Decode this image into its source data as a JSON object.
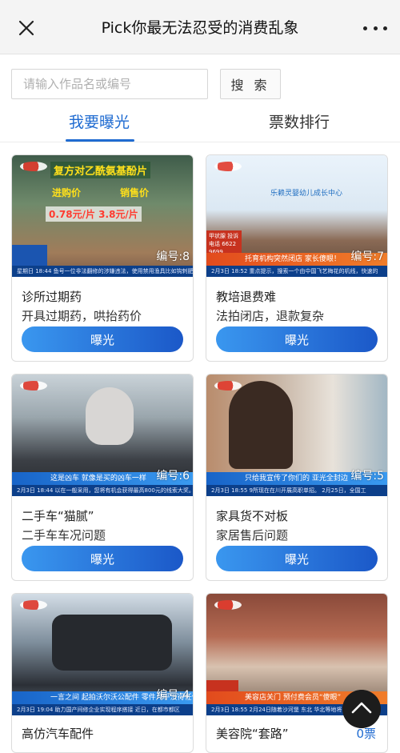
{
  "header": {
    "title": "Pick你最无法忍受的消费乱象",
    "close_icon": "close-icon",
    "more_icon": "more-icon"
  },
  "search": {
    "placeholder": "请输入作品名或编号",
    "button_label": "搜 索"
  },
  "tabs": [
    {
      "label": "我要曝光",
      "active": true
    },
    {
      "label": "票数排行",
      "active": false
    }
  ],
  "accent_color": "#1f6bd1",
  "button_label": "曝光",
  "cards": [
    {
      "name": "诊所过期药",
      "desc": "开具过期药，哄抬药价",
      "num": "编号:8",
      "headline": "复方对乙酰氨基酚片",
      "price_in": "进购价",
      "price_out": "销售价",
      "prices": "0.78元/片  3.8元/片",
      "caption": "星期日 18:44 鱼号一位非法翻修的涉嫌违法，使用禁用渔具比如钩刺肥料"
    },
    {
      "name": "教培退费难",
      "desc": "法拍闭店，退款复杂",
      "num": "编号:7",
      "headline": "乐赖灵婴幼儿成长中心",
      "badge": "甲状腺 投诉电话 6622 9699",
      "caption_red": "托育机构突然闭店 家长傻眼！",
      "caption": "2月3日 18:52 重点提示，搜索一个由中国飞艺梅花的机线，快速的"
    },
    {
      "name": "二手车“猫腻”",
      "desc": "二手车车况问题",
      "num": "编号:6",
      "caption": "这是凶车 就像是买的凶车一样",
      "ticker": "2月3日 18:44 以在一般采用，您将有机会获得最高800元的线索大奖。"
    },
    {
      "name": "家具货不对板",
      "desc": "家居售后问题",
      "num": "编号:5",
      "caption": "只给我宣传了你们的 亚光全封边",
      "ticker": "2月3日 18:55 9所现在在川开展高职单招。 2月25日，全国工"
    },
    {
      "name": "高仿汽车配件",
      "desc": "",
      "num": "编号:4",
      "caption": "一言之间 起拍沃尔沃公配件 零件几乎没得任何的",
      "ticker": "2月3日 19:04 助力国产间修企业实现程序搭接  近日，在都市都区"
    },
    {
      "name": "美容院“套路”",
      "desc": "",
      "num": "",
      "votes": "0票",
      "caption_red": "美容店关门 预付费会员“傻眼”",
      "ticker": "2月3日 18:55 2月24日随着沙河堡 东北 华北等地将"
    }
  ]
}
